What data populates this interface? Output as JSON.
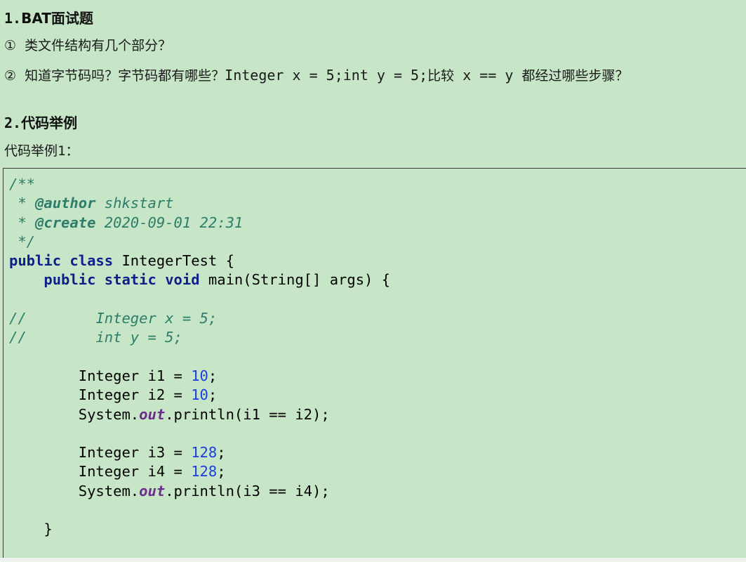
{
  "section1": {
    "number": "1.",
    "title": "BAT面试题",
    "q1_marker": "①",
    "q1_text": "类文件结构有几个部分？",
    "q2_marker": "②",
    "q2_text_a": "知道字节码吗？字节码都有哪些？",
    "q2_code_a": "Integer x = 5;int y = 5;",
    "q2_text_b": "比较",
    "q2_code_b": " x == y ",
    "q2_text_c": "都经过哪些步骤？"
  },
  "section2": {
    "number": "2.",
    "title": "代码举例",
    "example_label": "代码举例",
    "example_num": "1",
    "example_colon": "："
  },
  "code": {
    "javadoc_open": "/**",
    "javadoc_star": " * ",
    "author_tag": "@author",
    "author_value": " shkstart",
    "create_tag": "@create",
    "create_value": " 2020-09-01 22:31",
    "javadoc_close": " */",
    "kw_public": "public",
    "kw_class": "class",
    "class_name": " IntegerTest {",
    "kw_static": "static",
    "kw_void": "void",
    "main_sig": " main(String[] args) {",
    "comment_slashes": "//",
    "comment_line1": "Integer x = 5;",
    "comment_line2": "int y = 5;",
    "decl_i1": "Integer i1 = ",
    "decl_i2": "Integer i2 = ",
    "val_10": "10",
    "decl_i3": "Integer i3 = ",
    "decl_i4": "Integer i4 = ",
    "val_128": "128",
    "semicolon": ";",
    "sys": "System.",
    "out_field": "out",
    "println_1": ".println(i1 == i2);",
    "println_2": ".println(i3 == i4);",
    "close_brace": "}"
  }
}
